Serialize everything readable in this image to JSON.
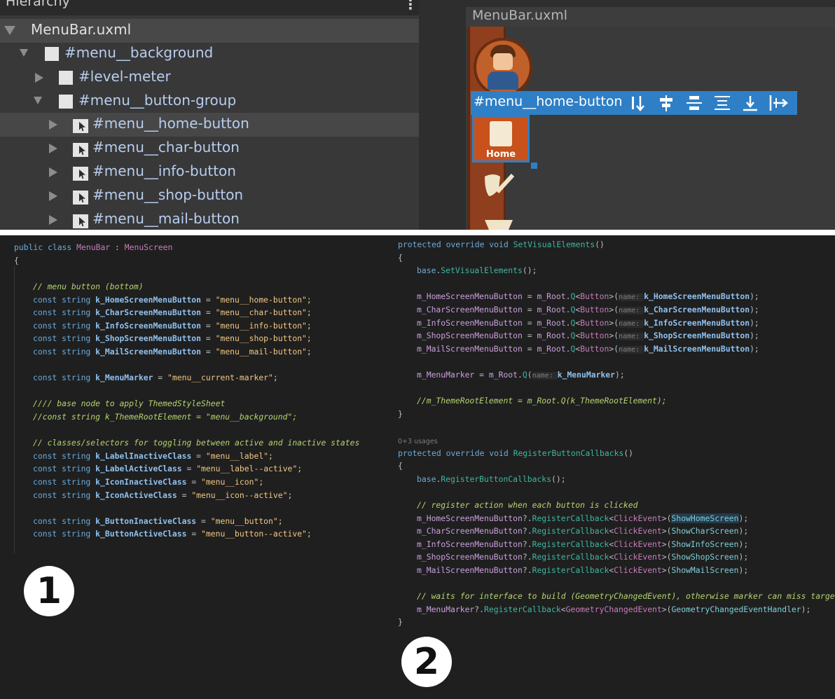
{
  "hierarchy": {
    "title": "Hierarchy",
    "menu_dots": "⋮",
    "root": "MenuBar.uxml",
    "items": [
      {
        "label": "#menu__background"
      },
      {
        "label": "#level-meter"
      },
      {
        "label": "#menu__button-group"
      },
      {
        "label": "#menu__home-button"
      },
      {
        "label": "#menu__char-button"
      },
      {
        "label": "#menu__info-button"
      },
      {
        "label": "#menu__shop-button"
      },
      {
        "label": "#menu__mail-button"
      }
    ]
  },
  "viewport": {
    "title": "MenuBar.uxml",
    "selected_label": "#menu__home-button",
    "home_button_label": "Home",
    "tools": [
      "align-stretch-icon",
      "align-center-icon",
      "align-middle-icon",
      "justify-space-icon",
      "align-end-icon",
      "direction-row-icon"
    ]
  },
  "code_left": {
    "class_decl": "public class MenuBar : MenuScreen",
    "open_brace": "{",
    "comment_menu": "// menu button (bottom)",
    "consts_buttons": [
      {
        "name": "k_HomeScreenMenuButton",
        "value": "\"menu__home-button\";"
      },
      {
        "name": "k_CharScreenMenuButton",
        "value": "\"menu__char-button\";"
      },
      {
        "name": "k_InfoScreenMenuButton",
        "value": "\"menu__info-button\";"
      },
      {
        "name": "k_ShopScreenMenuButton",
        "value": "\"menu__shop-button\";"
      },
      {
        "name": "k_MailScreenMenuButton",
        "value": "\"menu__mail-button\";"
      }
    ],
    "const_marker": {
      "name": "k_MenuMarker",
      "value": "\"menu__current-marker\";"
    },
    "comment_base": "//// base node to apply ThemedStyleSheet",
    "comment_theme": "//const string k_ThemeRootElement = \"menu__background\";",
    "comment_classes": "// classes/selectors for toggling between active and inactive states",
    "consts_classes": [
      {
        "name": "k_LabelInactiveClass",
        "value": "\"menu__label\";"
      },
      {
        "name": "k_LabelActiveClass",
        "value": "\"menu__label--active\";"
      },
      {
        "name": "k_IconInactiveClass",
        "value": "\"menu__icon\";"
      },
      {
        "name": "k_IconActiveClass",
        "value": "\"menu__icon--active\";"
      }
    ],
    "consts_buttons_class": [
      {
        "name": "k_ButtonInactiveClass",
        "value": "\"menu__button\";"
      },
      {
        "name": "k_ButtonActiveClass",
        "value": "\"menu__button--active\";"
      }
    ]
  },
  "code_right": {
    "method1": "protected override void SetVisualElements()",
    "base1": "SetVisualElements",
    "queries": [
      {
        "field": "m_HomeScreenMenuButton",
        "arg": "k_HomeScreenMenuButton"
      },
      {
        "field": "m_CharScreenMenuButton",
        "arg": "k_CharScreenMenuButton"
      },
      {
        "field": "m_InfoScreenMenuButton",
        "arg": "k_InfoScreenMenuButton"
      },
      {
        "field": "m_ShopScreenMenuButton",
        "arg": "k_ShopScreenMenuButton"
      },
      {
        "field": "m_MailScreenMenuButton",
        "arg": "k_MailScreenMenuButton"
      }
    ],
    "marker_query": {
      "field": "m_MenuMarker",
      "arg": "k_MenuMarker"
    },
    "theme_comment": "//m_ThemeRootElement = m_Root.Q(k_ThemeRootElement);",
    "usages": "0+3 usages",
    "method2": "protected override void RegisterButtonCallbacks()",
    "base2": "RegisterButtonCallbacks",
    "comment_register": "// register action when each button is clicked",
    "callbacks": [
      {
        "field": "m_HomeScreenMenuButton",
        "handler": "ShowHomeScreen"
      },
      {
        "field": "m_CharScreenMenuButton",
        "handler": "ShowCharScreen"
      },
      {
        "field": "m_InfoScreenMenuButton",
        "handler": "ShowInfoScreen"
      },
      {
        "field": "m_ShopScreenMenuButton",
        "handler": "ShowShopScreen"
      },
      {
        "field": "m_MailScreenMenuButton",
        "handler": "ShowMailScreen"
      }
    ],
    "comment_wait": "// waits for interface to build (GeometryChangedEvent), otherwise marker can miss target",
    "marker_callback": {
      "field": "m_MenuMarker",
      "event": "GeometryChangedEvent",
      "handler": "GeometryChangedEventHandler"
    }
  },
  "badges": {
    "one": "1",
    "two": "2"
  }
}
